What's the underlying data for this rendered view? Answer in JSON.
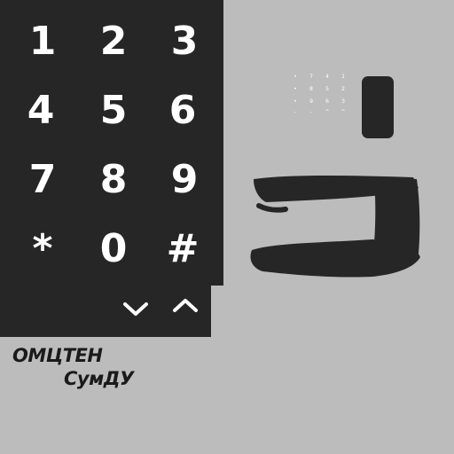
{
  "keypad": {
    "keys": [
      "1",
      "2",
      "3",
      "4",
      "5",
      "6",
      "7",
      "8",
      "9",
      "*",
      "0",
      "#"
    ],
    "down_icon": "chevron-down-icon",
    "up_icon": "chevron-up-icon"
  },
  "brand": {
    "line1": "ОМЦТЕН",
    "line2": "СумДУ"
  },
  "mini_keypad": {
    "keys": [
      "•",
      "7",
      "4",
      "1",
      "•",
      "8",
      "5",
      "2",
      "•",
      "9",
      "6",
      "3",
      "-",
      "-",
      "^",
      "^"
    ]
  },
  "colors": {
    "background": "#bcbcbc",
    "panel": "#262626",
    "key_text": "#ffffff"
  }
}
